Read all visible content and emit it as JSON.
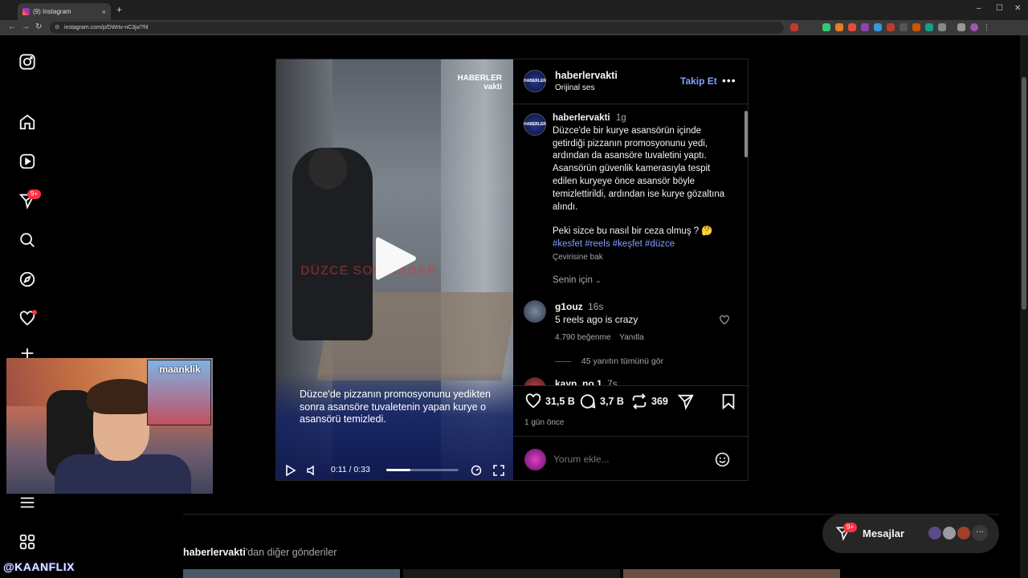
{
  "browser": {
    "tab_title": "(9) Instagram",
    "tab_close": "×",
    "new_tab": "+",
    "url": "instagram.com/p/DWrtv-nC3jx/?hl",
    "win_minimize": "–",
    "win_maximize": "☐",
    "win_close": "✕"
  },
  "sidebar": {
    "messages_badge": "9+"
  },
  "post": {
    "video": {
      "brand_logo_line1": "HABERLER",
      "brand_logo_line2": "vakti",
      "watermark": "DÜZCE SON HABER",
      "caption": "Düzce'de pizzanın promosyonunu yedikten sonra asansöre tuvaletenin yapan kurye o asansörü temizledi.",
      "time": "0:11 / 0:33",
      "progress_fraction": 0.33
    },
    "header": {
      "username": "haberlervakti",
      "audio": "Orijinal ses",
      "follow": "Takip Et",
      "more": "•••"
    },
    "caption": {
      "username": "haberlervakti",
      "age": "1g",
      "text": "Düzce'de bir kurye asansörün içinde getirdiği pizzanın promosyonunu yedi, ardından da asansöre tuvaletini yaptı. Asansörün güvenlik kamerasıyla tespit edilen kuryeye önce asansör böyle temizlettirildi, ardından ise kurye gözaltına alındı.",
      "question": "Peki sizce bu nasıl bir ceza olmuş ? 🤔",
      "hashtags": "#kesfet #reels #keşfet #düzce",
      "see_translation": "Çevirisine bak"
    },
    "sort_label": "Senin için",
    "comments": [
      {
        "username": "g1ouz",
        "age": "16s",
        "text": "5 reels ago is crazy",
        "likes": "4.790 beğenme",
        "reply": "Yanıtla",
        "view_replies": "45 yanıtın tümünü gör"
      },
      {
        "username": "kayn_no.1",
        "age": "7s"
      }
    ],
    "actions": {
      "likes": "31,5 B",
      "comments": "3,7 B",
      "reposts": "369"
    },
    "posted_ago": "1 gün önce",
    "add_comment_placeholder": "Yorum ekle..."
  },
  "webcam": {
    "inset_name": "maanklik"
  },
  "watermark_handle": "@KAANFLIX",
  "more_posts": {
    "username": "haberlervakti",
    "suffix": "'dan diğer gönderiler"
  },
  "messages_pill": {
    "label": "Mesajlar",
    "badge": "9+",
    "more": "···"
  },
  "colors": {
    "accent_blue": "#7fa0ff",
    "badge_red": "#ff3040",
    "background": "#000000"
  }
}
